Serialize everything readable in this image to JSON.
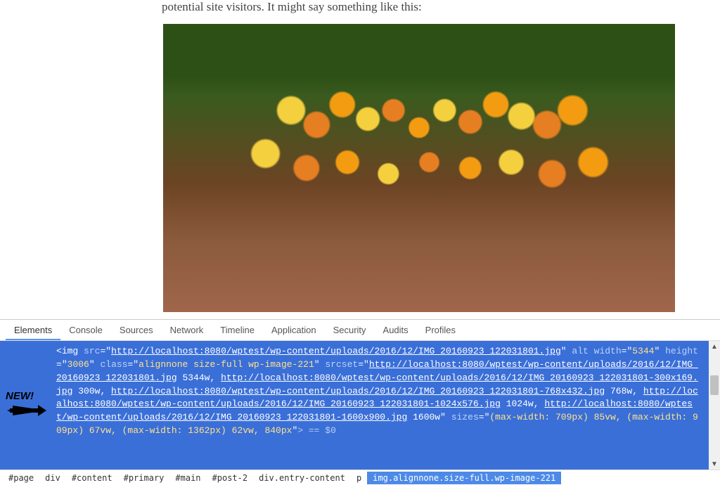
{
  "page": {
    "intro_text": "potential site visitors. It might say something like this:"
  },
  "devtools": {
    "tabs": [
      "Elements",
      "Console",
      "Sources",
      "Network",
      "Timeline",
      "Application",
      "Security",
      "Audits",
      "Profiles"
    ],
    "active_tab": "Elements",
    "annotation": "NEW!",
    "code": {
      "tag": "img",
      "src": "http://localhost:8080/wptest/wp-content/uploads/2016/12/IMG_20160923_122031801.jpg",
      "alt": "",
      "width": "5344",
      "height": "3006",
      "class": "alignnone size-full wp-image-221",
      "srcset_items": [
        {
          "url": "http://localhost:8080/wptest/wp-content/uploads/2016/12/IMG_20160923_122031801.jpg",
          "w": "5344w"
        },
        {
          "url": "http://localhost:8080/wptest/wp-content/uploads/2016/12/IMG_20160923_122031801-300x169.jpg",
          "w": "300w"
        },
        {
          "url": "http://localhost:8080/wptest/wp-content/uploads/2016/12/IMG_20160923_122031801-768x432.jpg",
          "w": "768w"
        },
        {
          "url": "http://localhost:8080/wptest/wp-content/uploads/2016/12/IMG_20160923_122031801-1024x576.jpg",
          "w": "1024w"
        },
        {
          "url": "http://localhost:8080/wptest/wp-content/uploads/2016/12/IMG_20160923_122031801-1600x900.jpg",
          "w": "1600w"
        }
      ],
      "sizes": "(max-width: 709px) 85vw, (max-width: 909px) 67vw, (max-width: 1362px) 62vw, 840px",
      "tail": "> == $0"
    },
    "breadcrumb": [
      "#page",
      "div",
      "#content",
      "#primary",
      "#main",
      "#post-2",
      "div.entry-content",
      "p",
      "img.alignnone.size-full.wp-image-221"
    ]
  }
}
